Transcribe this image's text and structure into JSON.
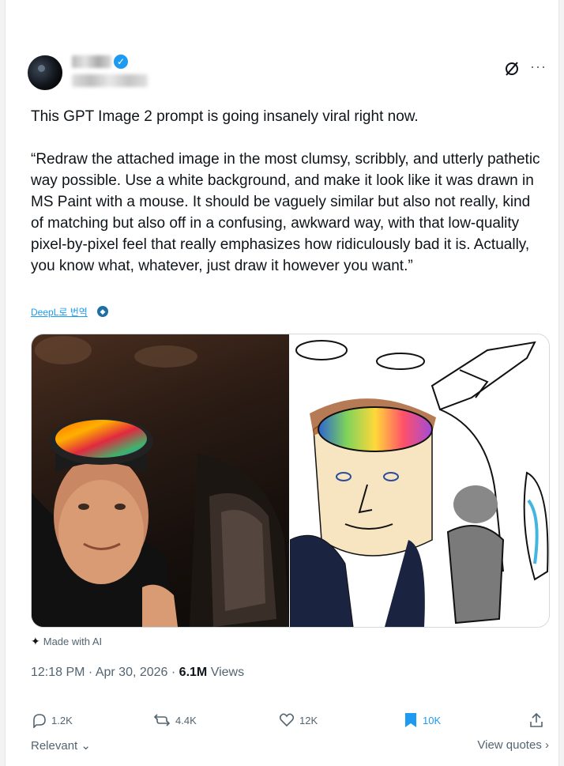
{
  "tweet": {
    "text_p1": "This GPT Image 2 prompt is going insanely viral right now.",
    "text_p2": "“Redraw the attached image in the most clumsy, scribbly, and utterly pathetic way possible. Use a white background, and make it look like it was drawn in MS Paint with a mouse. It should be vaguely similar but also not really, kind of matching but also off in a confusing, awkward way, with that low-quality pixel-by-pixel feel that really emphasizes how ridiculously bad it is. Actually, you know what, whatever, just draw it however you want.”",
    "translate_label": "DeepL로 번역"
  },
  "media": {
    "ai_badge": "Made with AI"
  },
  "meta": {
    "time": "12:18 PM",
    "separator": " · ",
    "date": "Apr 30, 2026",
    "views_count": "6.1M",
    "views_label": "Views"
  },
  "actions": {
    "replies": "1.2K",
    "reposts": "4.4K",
    "likes": "12K",
    "bookmarks": "10K"
  },
  "footer": {
    "sort_label": "Relevant",
    "view_quotes": "View quotes"
  },
  "icons": {
    "more": "more-icon",
    "grok": "grok-icon",
    "verified": "verified-badge-icon"
  },
  "colors": {
    "accent": "#1d9bf0",
    "muted": "#536471",
    "text": "#0f1419"
  }
}
